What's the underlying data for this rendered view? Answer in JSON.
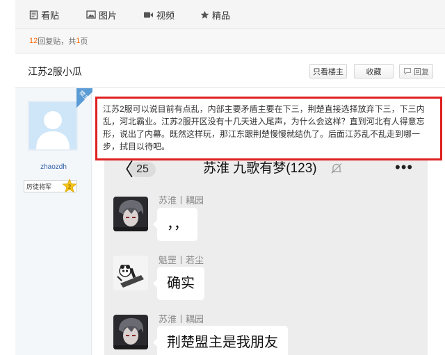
{
  "tabs": [
    {
      "label": "看贴",
      "icon": "document-icon"
    },
    {
      "label": "图片",
      "icon": "image-icon"
    },
    {
      "label": "视频",
      "icon": "video-icon"
    },
    {
      "label": "精品",
      "icon": "star-icon"
    }
  ],
  "reply_info": {
    "count": "12",
    "count_suffix": " 回复贴，共",
    "pages": "1",
    "pages_suffix": "页"
  },
  "thread": {
    "title": "江苏2服小瓜",
    "buttons": {
      "only_op": "只看楼主",
      "favorite": "收藏",
      "reply": "回复"
    }
  },
  "author": {
    "username": "zhaozdh",
    "rank_title": "厉徒将军",
    "level": "2",
    "op_badge": "楼主"
  },
  "post": {
    "text": "江苏2服可以说目前有点乱，内部主要矛盾主要在下三，荆楚直接选择放弃下三，下三内乱，河北霸业。江苏2服开区没有十几天进入尾声，为什么会这样？直到河北有人得意忘形，说出了内幕。既然这样玩，那江东跟荆楚慢慢就结仇了。后面江苏乱不乱走到哪一步，拭目以待吧。"
  },
  "chat": {
    "back": "〈",
    "unread": "25",
    "group_name": "苏淮 九歌有梦(123)",
    "more": "•••",
    "messages": [
      {
        "sender": "苏淮丨耦园",
        "text": "，，"
      },
      {
        "sender": "魁罡丨若尘",
        "text": "确实"
      },
      {
        "sender": "苏淮丨耦园",
        "text": "荆楚盟主是我朋友"
      }
    ]
  },
  "colors": {
    "highlight_border": "#e02020",
    "link": "#2f5fa8",
    "accent": "#ff6600"
  }
}
